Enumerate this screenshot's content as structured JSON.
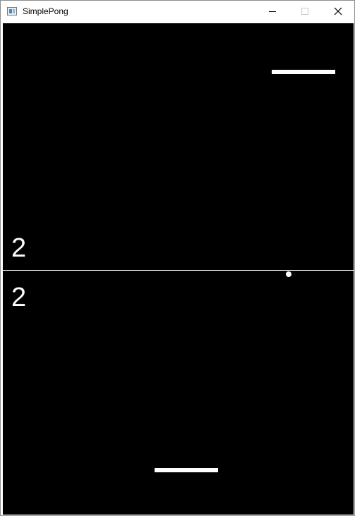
{
  "window": {
    "title": "SimplePong",
    "controls": {
      "minimize_icon": "minimize-icon",
      "maximize_icon": "maximize-icon",
      "close_icon": "close-icon"
    }
  },
  "game": {
    "background_color": "#000000",
    "foreground_color": "#ffffff",
    "score_top": "2",
    "score_bottom": "2"
  }
}
